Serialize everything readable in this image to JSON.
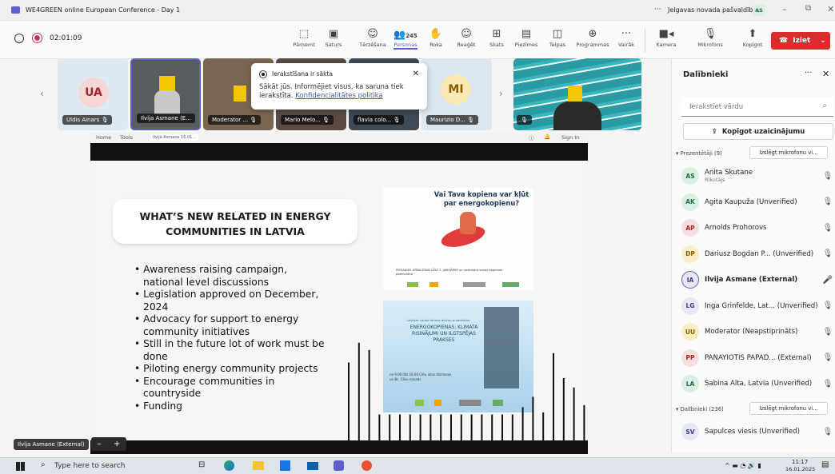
{
  "window": {
    "title": "WE4GREEN online European Conference - Day 1",
    "org": "Jelgavas novada pašvaldība",
    "user_initials": "AS"
  },
  "call": {
    "timer": "02:01:09",
    "people_count": "245"
  },
  "toolbar": {
    "items": [
      "Pārņemt",
      "Saturs",
      "Tērzēšana",
      "Personas",
      "Roka",
      "Reaģēt",
      "Skats",
      "Piezīmes",
      "Telpas",
      "Programmas",
      "Vairāk"
    ],
    "camera": "Kamera",
    "mic": "Mikrofons",
    "share": "Kopīgot",
    "leave": "Iziet"
  },
  "tiles": [
    {
      "initials": "UA",
      "name": "Uldis Ainars"
    },
    {
      "name": "Ilvija Asmane (E..."
    },
    {
      "name": "Moderator ..."
    },
    {
      "name": "Mario Melo..."
    },
    {
      "name": "flavia colo..."
    },
    {
      "initials": "MI",
      "name": "Maurizio D..."
    }
  ],
  "recording": {
    "title": "Ierakstīšana ir sākta",
    "text": "Sākāt jūs. Informējiet visus, ka saruna tiek ierakstīta.",
    "link": "Konfidencialitātes politika"
  },
  "share_bar": {
    "home": "Home",
    "tools": "Tools",
    "tab": "Ilvija Asmane 16.01...",
    "sign_in": "Sign In"
  },
  "slide": {
    "title_line1": "WHAT’S NEW RELATED IN ENERGY",
    "title_line2": "COMMUNITIES IN LATVIA",
    "bullets": [
      [
        "Awareness raising campaign,",
        "national level discussions"
      ],
      [
        "Legislation approved on December,",
        "2024"
      ],
      [
        "Advocacy for support to energy",
        "community initiatives"
      ],
      [
        "Still in the future lot of work must be",
        "done"
      ],
      [
        "Piloting energy community projects"
      ],
      [
        "Encourage communities in",
        "countryside"
      ],
      [
        "Funding"
      ]
    ],
    "poster1_title": "Vai Tava kopiena var kļūt par energokopienu?",
    "poster1_text": "PIESAKIES ATBALSTAM LĪDZ 7. JANVĀRIM un noskaidro savas kopienas potenciālu!",
    "poster2_small": "Latvijas Lauku forums aicina uz semināru",
    "poster2_title": "ENERGOKOPIENAS: KLIMATA RISINĀJUMI UN ILGTSPĒJAS PRAKSES",
    "poster2_date": "no 9.00 līdz 16.00 Ciltu ielas dzirnavas un Bc. Cēsu novads"
  },
  "presenter_label": "Ilvija Asmane (External)",
  "panel": {
    "title": "Dalībnieki",
    "search_placeholder": "Ierakstiet vārdu",
    "share_invite": "Kopīgot uzaicinājumu",
    "presenters_label": "Prezentētāji (9)",
    "mute_all": "Izslēgt mikrofonu vi...",
    "attendees_label": "Dalībnieki (236)",
    "presenters": [
      {
        "initials": "AS",
        "name": "Anita Skutane",
        "sub": "Rīkotājs",
        "bg": "#dcefe3",
        "fg": "#1f6e3d"
      },
      {
        "initials": "AK",
        "name": "Agita Kaupuža (Unverified)",
        "bg": "#dcefe3",
        "fg": "#1f6e3d"
      },
      {
        "initials": "AP",
        "name": "Arnolds Prohorovs",
        "bg": "#f9dede",
        "fg": "#a4262c"
      },
      {
        "initials": "DP",
        "name": "Dariusz Bogdan P... (Unverified)",
        "bg": "#fbeec5",
        "fg": "#8a5a00"
      },
      {
        "initials": "IA",
        "name": "Ilvija Asmane (External)",
        "bg": "#e6e8f5",
        "fg": "#3b3f80",
        "active": true
      },
      {
        "initials": "LG",
        "name": "Inga Grinfelde, Lat... (Unverified)",
        "bg": "#e6e8f5",
        "fg": "#3b3f80"
      },
      {
        "initials": "UU",
        "name": "Moderator (Neapstiprināts)",
        "bg": "#fbeec5",
        "fg": "#8a5a00"
      },
      {
        "initials": "PP",
        "name": "PANAYIOTIS PAPAD... (External)",
        "bg": "#f9dede",
        "fg": "#a4262c"
      },
      {
        "initials": "LA",
        "name": "Sabina Alta, Latvia (Unverified)",
        "bg": "#dcefe3",
        "fg": "#1f6e3d"
      }
    ],
    "attendees": [
      {
        "initials": "SV",
        "name": "Sapulces viesis (Unverified)",
        "bg": "#e6e8f5",
        "fg": "#3b3f80"
      }
    ]
  },
  "taskbar": {
    "search_placeholder": "Type here to search",
    "time": "11:17",
    "date": "16.01.2025"
  },
  "colors": {
    "leave": "#d92c2c",
    "accent": "#5b5fc7"
  }
}
